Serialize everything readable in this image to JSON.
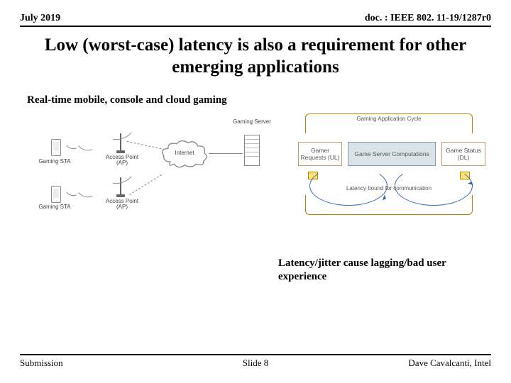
{
  "header": {
    "left": "July 2019",
    "right": "doc. : IEEE 802. 11-19/1287r0"
  },
  "title": "Low (worst-case) latency is also a requirement for other emerging applications",
  "subheading": "Real-time mobile, console and cloud gaming",
  "diagram_left": {
    "gaming_sta_1": "Gaming\nSTA",
    "gaming_sta_2": "Gaming\nSTA",
    "ap_1": "Access Point\n(AP)",
    "ap_2": "Access Point\n(AP)",
    "internet": "Internet",
    "server": "Gaming Server"
  },
  "diagram_right": {
    "top_label": "Gaming\nApplication Cycle",
    "left_box": "Gamer\nRequests (UL)",
    "mid_box": "Game Server Computations",
    "right_box": "Game\nStatus (DL)",
    "bottom_label": "Latency bound for\ncommunication"
  },
  "caption": "Latency/jitter cause lagging/bad user experience",
  "footer": {
    "left": "Submission",
    "center": "Slide 8",
    "right": "Dave Cavalcanti, Intel"
  }
}
